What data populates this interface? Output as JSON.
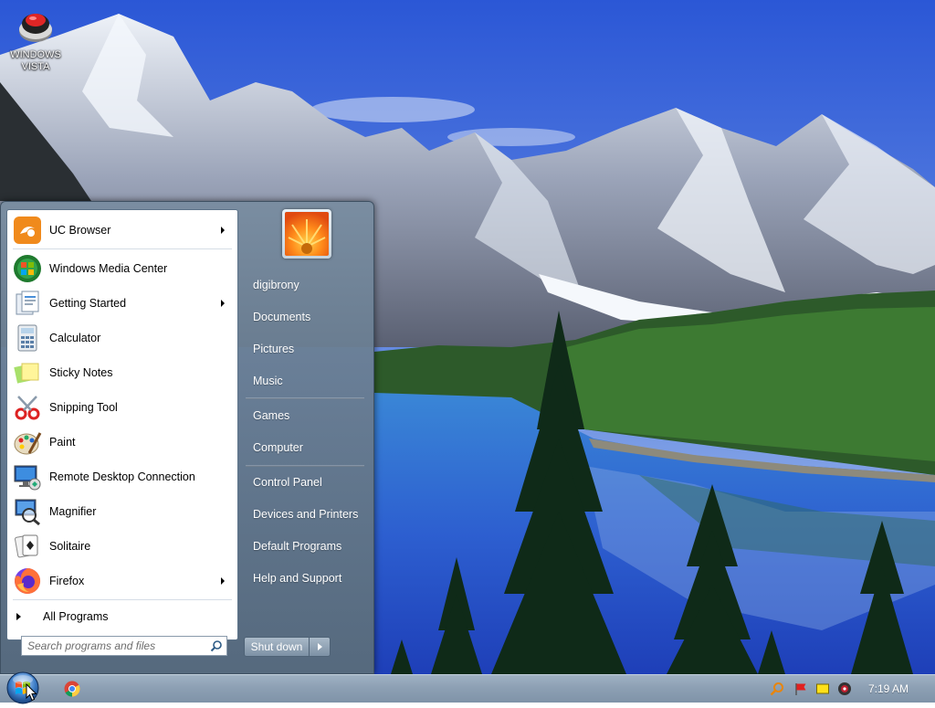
{
  "desktop": {
    "icon": {
      "label": "WINDOWS\nVISTA",
      "icon_name": "vista-logo-icon"
    }
  },
  "start_menu": {
    "programs": [
      {
        "label": "UC Browser",
        "icon": "uc-browser-icon",
        "has_submenu": true
      },
      {
        "label": "Windows Media Center",
        "icon": "media-center-icon",
        "has_submenu": false
      },
      {
        "label": "Getting Started",
        "icon": "getting-started-icon",
        "has_submenu": true
      },
      {
        "label": "Calculator",
        "icon": "calculator-icon",
        "has_submenu": false
      },
      {
        "label": "Sticky Notes",
        "icon": "sticky-notes-icon",
        "has_submenu": false
      },
      {
        "label": "Snipping Tool",
        "icon": "snipping-tool-icon",
        "has_submenu": false
      },
      {
        "label": "Paint",
        "icon": "paint-icon",
        "has_submenu": false
      },
      {
        "label": "Remote Desktop Connection",
        "icon": "remote-desktop-icon",
        "has_submenu": false
      },
      {
        "label": "Magnifier",
        "icon": "magnifier-icon",
        "has_submenu": false
      },
      {
        "label": "Solitaire",
        "icon": "solitaire-icon",
        "has_submenu": false
      },
      {
        "label": "Firefox",
        "icon": "firefox-icon",
        "has_submenu": true
      }
    ],
    "all_programs_label": "All Programs",
    "search_placeholder": "Search programs and files",
    "right_items": [
      {
        "label": "digibrony"
      },
      {
        "label": "Documents"
      },
      {
        "label": "Pictures"
      },
      {
        "label": "Music"
      },
      {
        "label": "Games"
      },
      {
        "label": "Computer"
      },
      {
        "label": "Control Panel"
      },
      {
        "label": "Devices and Printers"
      },
      {
        "label": "Default Programs"
      },
      {
        "label": "Help and Support"
      }
    ],
    "shutdown_label": "Shut down"
  },
  "taskbar": {
    "pinned": [
      {
        "icon": "chrome-icon"
      }
    ],
    "tray": [
      {
        "icon": "search-tray-icon"
      },
      {
        "icon": "action-center-flag-icon"
      },
      {
        "icon": "notes-tray-icon"
      },
      {
        "icon": "webcam-tray-icon"
      }
    ],
    "clock": "7:19 AM"
  },
  "colors": {
    "sky": "#2f62d8",
    "start_menu_glass": "#7a8ea2",
    "taskbar": "#8da0b4"
  }
}
